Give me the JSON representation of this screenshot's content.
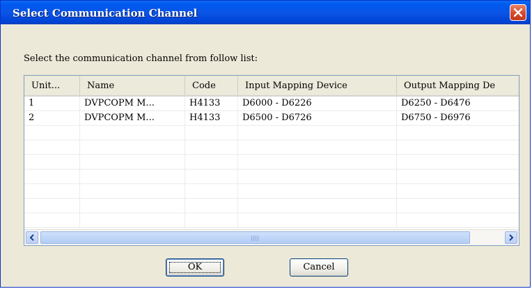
{
  "window": {
    "title": "Select Communication Channel",
    "close_icon": "close-icon"
  },
  "prompt": "Select the communication channel from follow list:",
  "table": {
    "columns": [
      "Unit...",
      "Name",
      "Code",
      "Input Mapping Device",
      "Output Mapping De"
    ],
    "rows": [
      [
        "1",
        "DVPCOPM M...",
        "H4133",
        "D6000 - D6226",
        "D6250 - D6476"
      ],
      [
        "2",
        "DVPCOPM M...",
        "H4133",
        "D6500 - D6726",
        "D6750 - D6976"
      ]
    ]
  },
  "scrollbar": {
    "left_icon": "arrow-left-icon",
    "right_icon": "arrow-right-icon"
  },
  "buttons": {
    "ok": "OK",
    "cancel": "Cancel"
  },
  "colors": {
    "titlebar": "#0a55e6",
    "dialog_bg": "#ece9d8",
    "close_button": "#d54a2a"
  }
}
